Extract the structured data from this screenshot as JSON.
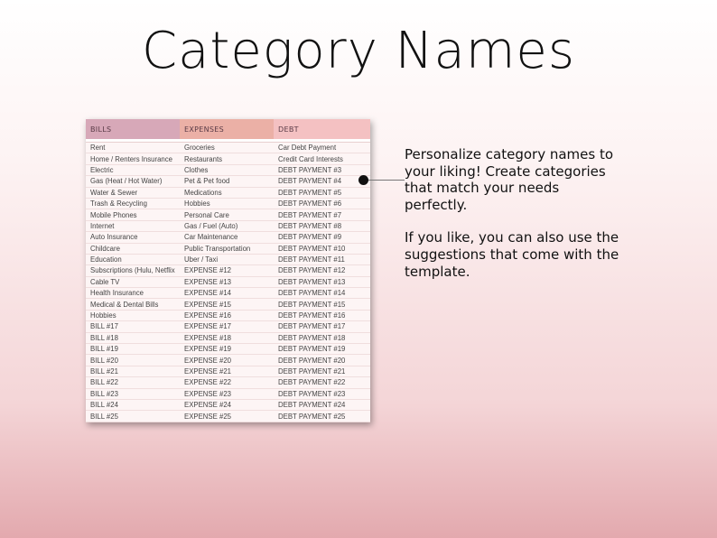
{
  "title": "Category Names",
  "table": {
    "headers": [
      "BILLS",
      "EXPENSES",
      "DEBT"
    ],
    "rows": [
      [
        "Rent",
        "Groceries",
        "Car Debt Payment"
      ],
      [
        "Home / Renters Insurance",
        "Restaurants",
        "Credit Card Interests"
      ],
      [
        "Electric",
        "Clothes",
        "DEBT PAYMENT #3"
      ],
      [
        "Gas (Heat / Hot Water)",
        "Pet & Pet food",
        "DEBT PAYMENT #4"
      ],
      [
        "Water & Sewer",
        "Medications",
        "DEBT PAYMENT #5"
      ],
      [
        "Trash & Recycling",
        "Hobbies",
        "DEBT PAYMENT #6"
      ],
      [
        "Mobile Phones",
        "Personal Care",
        "DEBT PAYMENT #7"
      ],
      [
        "Internet",
        "Gas / Fuel (Auto)",
        "DEBT PAYMENT #8"
      ],
      [
        "Auto Insurance",
        "Car Maintenance",
        "DEBT PAYMENT #9"
      ],
      [
        "Childcare",
        "Public Transportation",
        "DEBT PAYMENT #10"
      ],
      [
        "Education",
        "Uber / Taxi",
        "DEBT PAYMENT #11"
      ],
      [
        "Subscriptions (Hulu, Netflix",
        "EXPENSE #12",
        "DEBT PAYMENT #12"
      ],
      [
        "Cable TV",
        "EXPENSE #13",
        "DEBT PAYMENT #13"
      ],
      [
        "Health Insurance",
        "EXPENSE #14",
        "DEBT PAYMENT #14"
      ],
      [
        "Medical & Dental Bills",
        "EXPENSE #15",
        "DEBT PAYMENT #15"
      ],
      [
        "Hobbies",
        "EXPENSE #16",
        "DEBT PAYMENT #16"
      ],
      [
        "BILL #17",
        "EXPENSE #17",
        "DEBT PAYMENT #17"
      ],
      [
        "BILL #18",
        "EXPENSE #18",
        "DEBT PAYMENT #18"
      ],
      [
        "BILL #19",
        "EXPENSE #19",
        "DEBT PAYMENT #19"
      ],
      [
        "BILL #20",
        "EXPENSE #20",
        "DEBT PAYMENT #20"
      ],
      [
        "BILL #21",
        "EXPENSE #21",
        "DEBT PAYMENT #21"
      ],
      [
        "BILL #22",
        "EXPENSE #22",
        "DEBT PAYMENT #22"
      ],
      [
        "BILL #23",
        "EXPENSE #23",
        "DEBT PAYMENT #23"
      ],
      [
        "BILL #24",
        "EXPENSE #24",
        "DEBT PAYMENT #24"
      ],
      [
        "BILL #25",
        "EXPENSE #25",
        "DEBT PAYMENT #25"
      ]
    ]
  },
  "description": {
    "paragraph1": "Personalize category names to your liking! Create categories that match your needs perfectly.",
    "paragraph2": "If you like, you can also use the suggestions that come with the template."
  },
  "colors": {
    "bills_header": "#d7a8b8",
    "expenses_header": "#ebb0a6",
    "debt_header": "#f4c1c2"
  }
}
